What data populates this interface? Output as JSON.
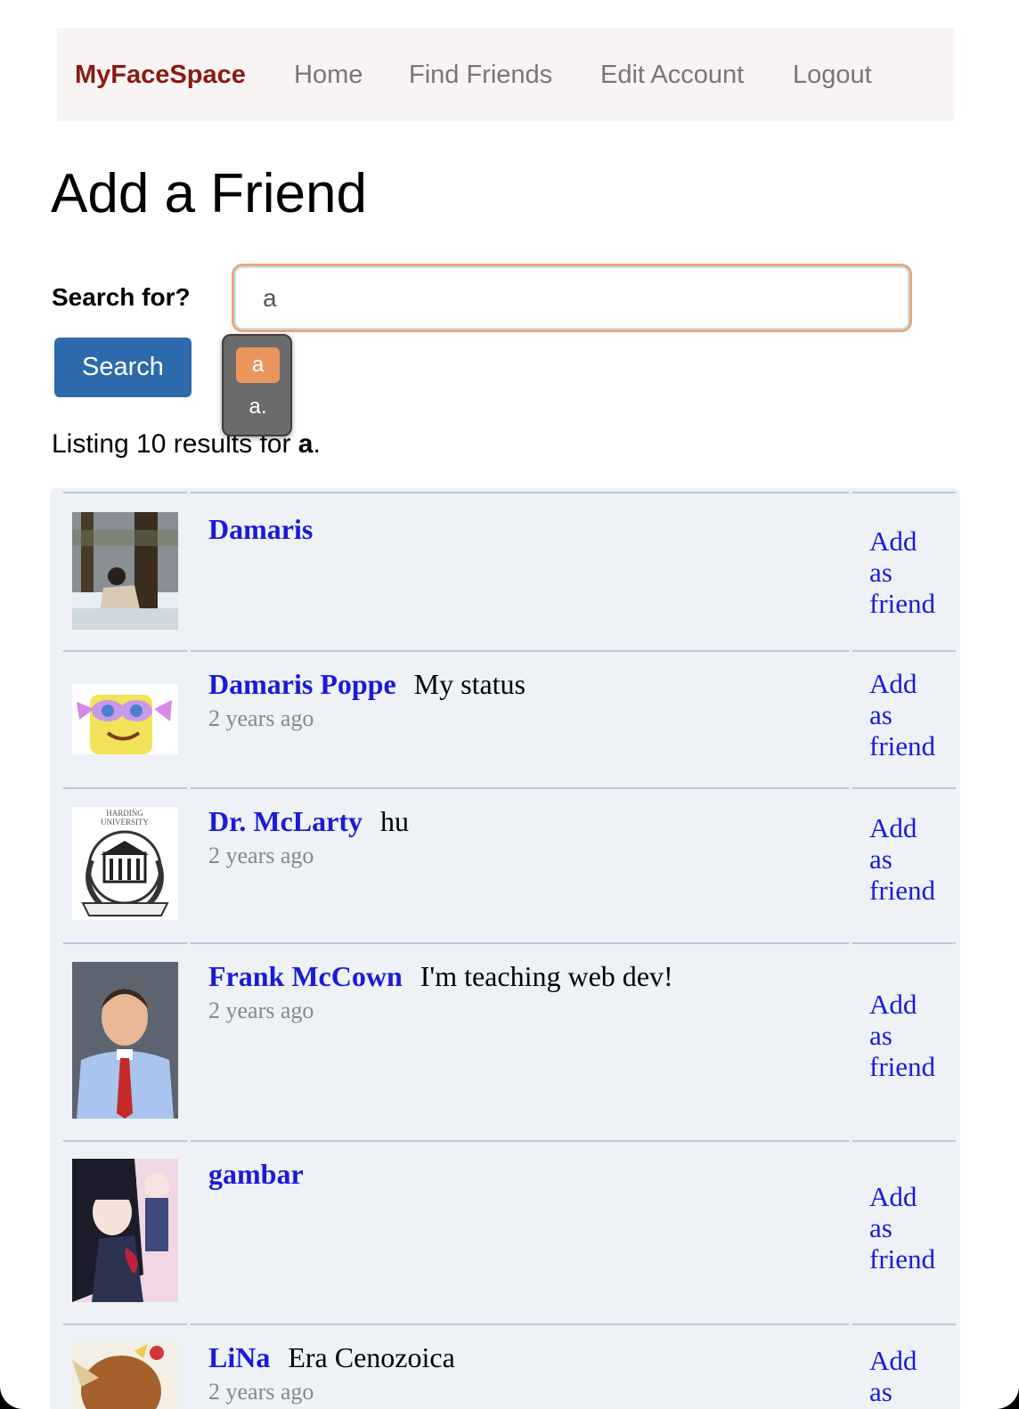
{
  "nav": {
    "brand": "MyFaceSpace",
    "links": [
      "Home",
      "Find Friends",
      "Edit Account",
      "Logout"
    ]
  },
  "title": "Add a Friend",
  "search": {
    "label": "Search for?",
    "value": "a",
    "button": "Search",
    "suggestions": [
      "a",
      "a."
    ]
  },
  "listing": {
    "prefix": "Listing 10 results for ",
    "query": "a",
    "suffix": "."
  },
  "results": [
    {
      "name": "Damaris",
      "status": "",
      "ago": "",
      "action": "Add as friend"
    },
    {
      "name": "Damaris Poppe",
      "status": "My status",
      "ago": "2 years ago",
      "action": "Add as friend"
    },
    {
      "name": "Dr. McLarty",
      "status": "hu",
      "ago": "2 years ago",
      "action": "Add as friend"
    },
    {
      "name": "Frank McCown",
      "status": "I'm teaching web dev!",
      "ago": "2 years ago",
      "action": "Add as friend"
    },
    {
      "name": "gambar",
      "status": "",
      "ago": "",
      "action": "Add as friend"
    },
    {
      "name": "LiNa",
      "status": "Era Cenozoica",
      "ago": "2 years ago",
      "action": "Add as friend"
    }
  ],
  "avatar_seal_text": "HARDING UNIVERSITY"
}
